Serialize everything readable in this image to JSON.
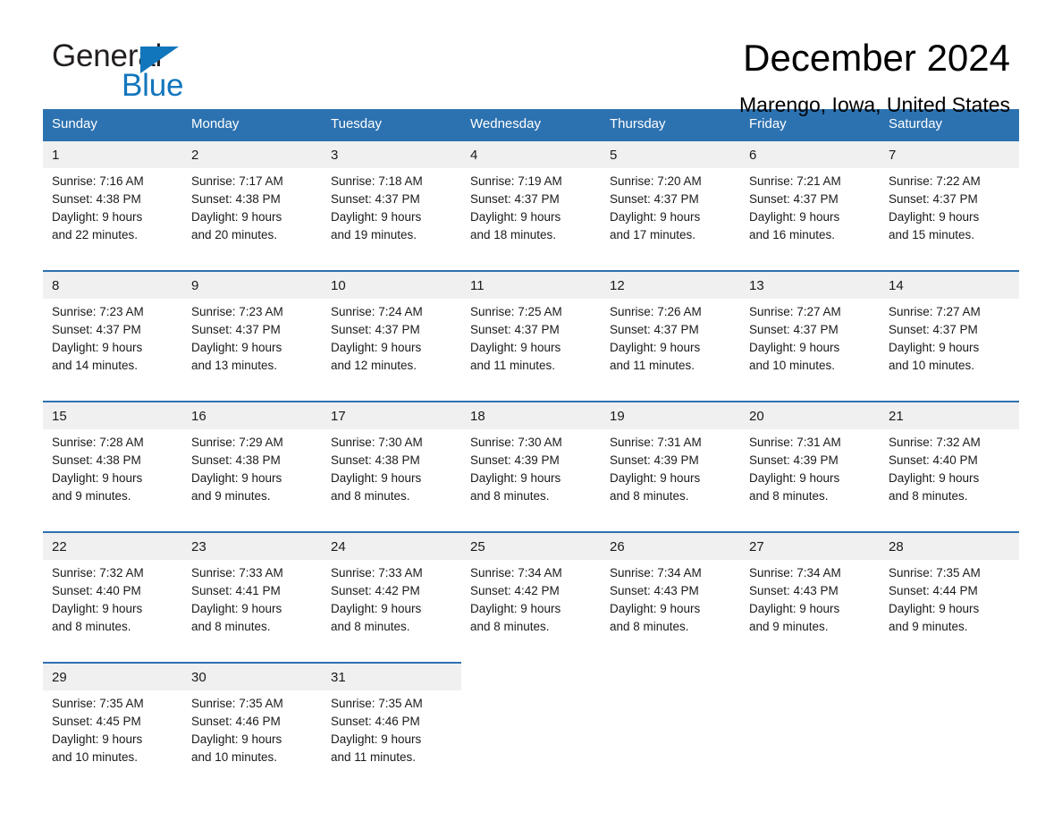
{
  "brand": {
    "word1": "General",
    "word2": "Blue",
    "accent_color": "#1276bc",
    "triangle_icon": "triangle-icon"
  },
  "header": {
    "title": "December 2024",
    "subtitle": "Marengo, Iowa, United States"
  },
  "theme": {
    "header_bar": "#2d72b0",
    "daynum_bg": "#f0f0f0",
    "cell_bg": "#ffffff",
    "text": "#1a1a1a"
  },
  "calendar": {
    "weekday_headers": [
      "Sunday",
      "Monday",
      "Tuesday",
      "Wednesday",
      "Thursday",
      "Friday",
      "Saturday"
    ],
    "labels": {
      "sunrise": "Sunrise:",
      "sunset": "Sunset:",
      "daylight": "Daylight:"
    },
    "weeks": [
      [
        {
          "day": "1",
          "sunrise": "Sunrise: 7:16 AM",
          "sunset": "Sunset: 4:38 PM",
          "daylight_1": "Daylight: 9 hours",
          "daylight_2": "and 22 minutes."
        },
        {
          "day": "2",
          "sunrise": "Sunrise: 7:17 AM",
          "sunset": "Sunset: 4:38 PM",
          "daylight_1": "Daylight: 9 hours",
          "daylight_2": "and 20 minutes."
        },
        {
          "day": "3",
          "sunrise": "Sunrise: 7:18 AM",
          "sunset": "Sunset: 4:37 PM",
          "daylight_1": "Daylight: 9 hours",
          "daylight_2": "and 19 minutes."
        },
        {
          "day": "4",
          "sunrise": "Sunrise: 7:19 AM",
          "sunset": "Sunset: 4:37 PM",
          "daylight_1": "Daylight: 9 hours",
          "daylight_2": "and 18 minutes."
        },
        {
          "day": "5",
          "sunrise": "Sunrise: 7:20 AM",
          "sunset": "Sunset: 4:37 PM",
          "daylight_1": "Daylight: 9 hours",
          "daylight_2": "and 17 minutes."
        },
        {
          "day": "6",
          "sunrise": "Sunrise: 7:21 AM",
          "sunset": "Sunset: 4:37 PM",
          "daylight_1": "Daylight: 9 hours",
          "daylight_2": "and 16 minutes."
        },
        {
          "day": "7",
          "sunrise": "Sunrise: 7:22 AM",
          "sunset": "Sunset: 4:37 PM",
          "daylight_1": "Daylight: 9 hours",
          "daylight_2": "and 15 minutes."
        }
      ],
      [
        {
          "day": "8",
          "sunrise": "Sunrise: 7:23 AM",
          "sunset": "Sunset: 4:37 PM",
          "daylight_1": "Daylight: 9 hours",
          "daylight_2": "and 14 minutes."
        },
        {
          "day": "9",
          "sunrise": "Sunrise: 7:23 AM",
          "sunset": "Sunset: 4:37 PM",
          "daylight_1": "Daylight: 9 hours",
          "daylight_2": "and 13 minutes."
        },
        {
          "day": "10",
          "sunrise": "Sunrise: 7:24 AM",
          "sunset": "Sunset: 4:37 PM",
          "daylight_1": "Daylight: 9 hours",
          "daylight_2": "and 12 minutes."
        },
        {
          "day": "11",
          "sunrise": "Sunrise: 7:25 AM",
          "sunset": "Sunset: 4:37 PM",
          "daylight_1": "Daylight: 9 hours",
          "daylight_2": "and 11 minutes."
        },
        {
          "day": "12",
          "sunrise": "Sunrise: 7:26 AM",
          "sunset": "Sunset: 4:37 PM",
          "daylight_1": "Daylight: 9 hours",
          "daylight_2": "and 11 minutes."
        },
        {
          "day": "13",
          "sunrise": "Sunrise: 7:27 AM",
          "sunset": "Sunset: 4:37 PM",
          "daylight_1": "Daylight: 9 hours",
          "daylight_2": "and 10 minutes."
        },
        {
          "day": "14",
          "sunrise": "Sunrise: 7:27 AM",
          "sunset": "Sunset: 4:37 PM",
          "daylight_1": "Daylight: 9 hours",
          "daylight_2": "and 10 minutes."
        }
      ],
      [
        {
          "day": "15",
          "sunrise": "Sunrise: 7:28 AM",
          "sunset": "Sunset: 4:38 PM",
          "daylight_1": "Daylight: 9 hours",
          "daylight_2": "and 9 minutes."
        },
        {
          "day": "16",
          "sunrise": "Sunrise: 7:29 AM",
          "sunset": "Sunset: 4:38 PM",
          "daylight_1": "Daylight: 9 hours",
          "daylight_2": "and 9 minutes."
        },
        {
          "day": "17",
          "sunrise": "Sunrise: 7:30 AM",
          "sunset": "Sunset: 4:38 PM",
          "daylight_1": "Daylight: 9 hours",
          "daylight_2": "and 8 minutes."
        },
        {
          "day": "18",
          "sunrise": "Sunrise: 7:30 AM",
          "sunset": "Sunset: 4:39 PM",
          "daylight_1": "Daylight: 9 hours",
          "daylight_2": "and 8 minutes."
        },
        {
          "day": "19",
          "sunrise": "Sunrise: 7:31 AM",
          "sunset": "Sunset: 4:39 PM",
          "daylight_1": "Daylight: 9 hours",
          "daylight_2": "and 8 minutes."
        },
        {
          "day": "20",
          "sunrise": "Sunrise: 7:31 AM",
          "sunset": "Sunset: 4:39 PM",
          "daylight_1": "Daylight: 9 hours",
          "daylight_2": "and 8 minutes."
        },
        {
          "day": "21",
          "sunrise": "Sunrise: 7:32 AM",
          "sunset": "Sunset: 4:40 PM",
          "daylight_1": "Daylight: 9 hours",
          "daylight_2": "and 8 minutes."
        }
      ],
      [
        {
          "day": "22",
          "sunrise": "Sunrise: 7:32 AM",
          "sunset": "Sunset: 4:40 PM",
          "daylight_1": "Daylight: 9 hours",
          "daylight_2": "and 8 minutes."
        },
        {
          "day": "23",
          "sunrise": "Sunrise: 7:33 AM",
          "sunset": "Sunset: 4:41 PM",
          "daylight_1": "Daylight: 9 hours",
          "daylight_2": "and 8 minutes."
        },
        {
          "day": "24",
          "sunrise": "Sunrise: 7:33 AM",
          "sunset": "Sunset: 4:42 PM",
          "daylight_1": "Daylight: 9 hours",
          "daylight_2": "and 8 minutes."
        },
        {
          "day": "25",
          "sunrise": "Sunrise: 7:34 AM",
          "sunset": "Sunset: 4:42 PM",
          "daylight_1": "Daylight: 9 hours",
          "daylight_2": "and 8 minutes."
        },
        {
          "day": "26",
          "sunrise": "Sunrise: 7:34 AM",
          "sunset": "Sunset: 4:43 PM",
          "daylight_1": "Daylight: 9 hours",
          "daylight_2": "and 8 minutes."
        },
        {
          "day": "27",
          "sunrise": "Sunrise: 7:34 AM",
          "sunset": "Sunset: 4:43 PM",
          "daylight_1": "Daylight: 9 hours",
          "daylight_2": "and 9 minutes."
        },
        {
          "day": "28",
          "sunrise": "Sunrise: 7:35 AM",
          "sunset": "Sunset: 4:44 PM",
          "daylight_1": "Daylight: 9 hours",
          "daylight_2": "and 9 minutes."
        }
      ],
      [
        {
          "day": "29",
          "sunrise": "Sunrise: 7:35 AM",
          "sunset": "Sunset: 4:45 PM",
          "daylight_1": "Daylight: 9 hours",
          "daylight_2": "and 10 minutes."
        },
        {
          "day": "30",
          "sunrise": "Sunrise: 7:35 AM",
          "sunset": "Sunset: 4:46 PM",
          "daylight_1": "Daylight: 9 hours",
          "daylight_2": "and 10 minutes."
        },
        {
          "day": "31",
          "sunrise": "Sunrise: 7:35 AM",
          "sunset": "Sunset: 4:46 PM",
          "daylight_1": "Daylight: 9 hours",
          "daylight_2": "and 11 minutes."
        },
        {
          "day": "",
          "sunrise": "",
          "sunset": "",
          "daylight_1": "",
          "daylight_2": ""
        },
        {
          "day": "",
          "sunrise": "",
          "sunset": "",
          "daylight_1": "",
          "daylight_2": ""
        },
        {
          "day": "",
          "sunrise": "",
          "sunset": "",
          "daylight_1": "",
          "daylight_2": ""
        },
        {
          "day": "",
          "sunrise": "",
          "sunset": "",
          "daylight_1": "",
          "daylight_2": ""
        }
      ]
    ]
  }
}
